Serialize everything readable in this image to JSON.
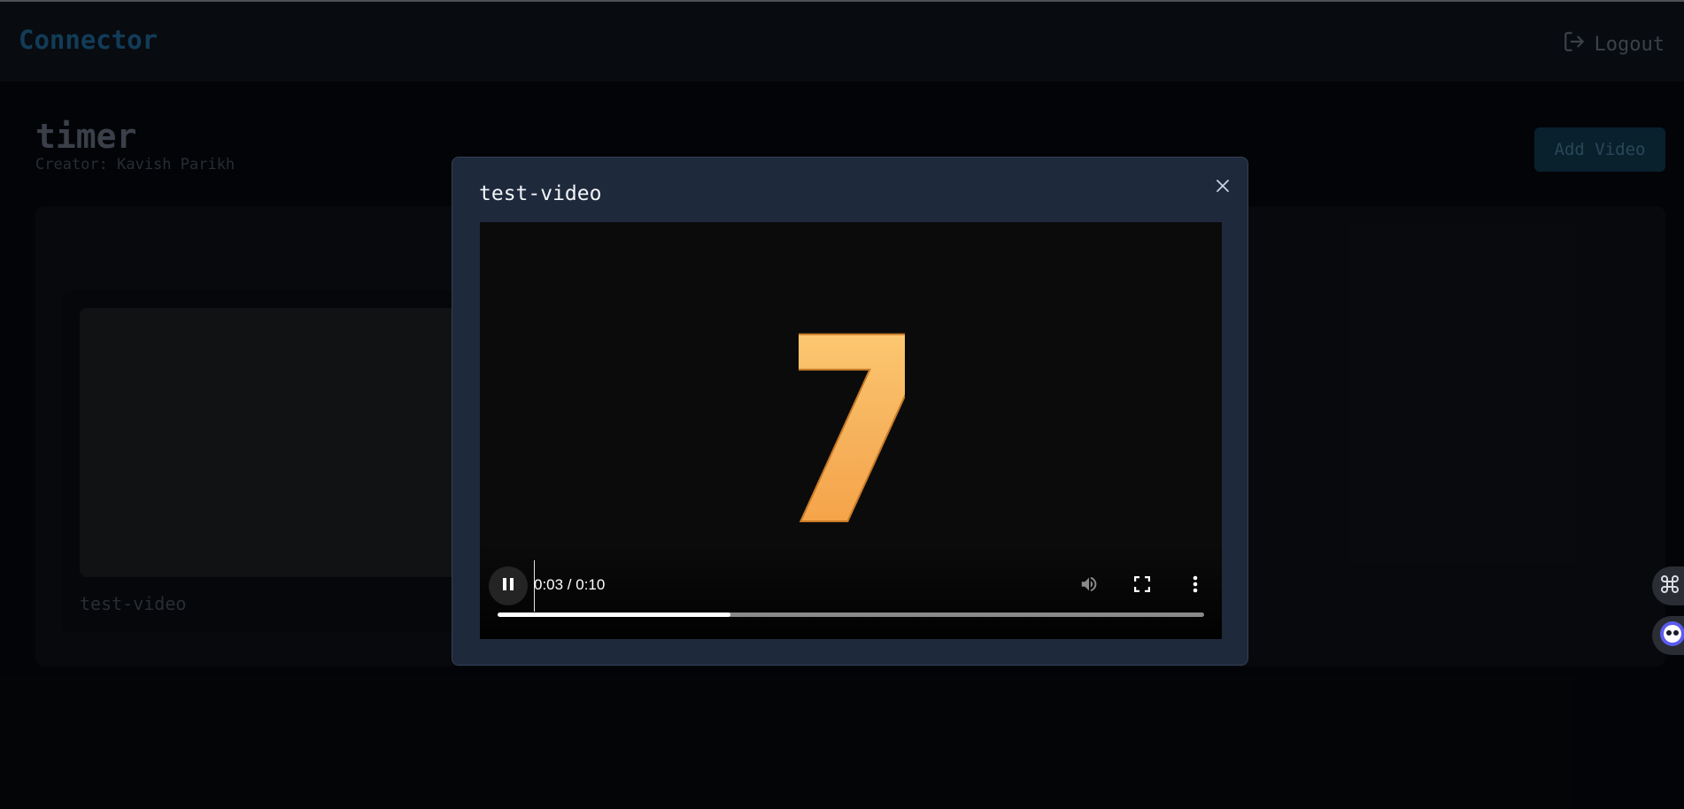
{
  "navbar": {
    "brand": "Connector",
    "logout_label": "Logout"
  },
  "page": {
    "title": "timer",
    "creator": "Creator: Kavish Parikh",
    "add_video_label": "Add Video"
  },
  "videos": [
    {
      "title": "test-video"
    }
  ],
  "modal": {
    "title": "test-video",
    "video_frame_number": "7",
    "player": {
      "time": "0:03 / 0:10",
      "progress_fraction": 0.33,
      "state": "playing"
    }
  },
  "colors": {
    "brand": "#1c5d87",
    "modal_bg": "#1e293b",
    "number_gold": "#f2a64a"
  },
  "icons": {
    "logout": "logout-icon",
    "close": "close-icon",
    "pause": "pause-icon",
    "volume": "volume-icon",
    "fullscreen": "fullscreen-icon",
    "more": "more-vertical-icon",
    "command": "command-icon",
    "assistant": "assistant-bot-icon"
  }
}
